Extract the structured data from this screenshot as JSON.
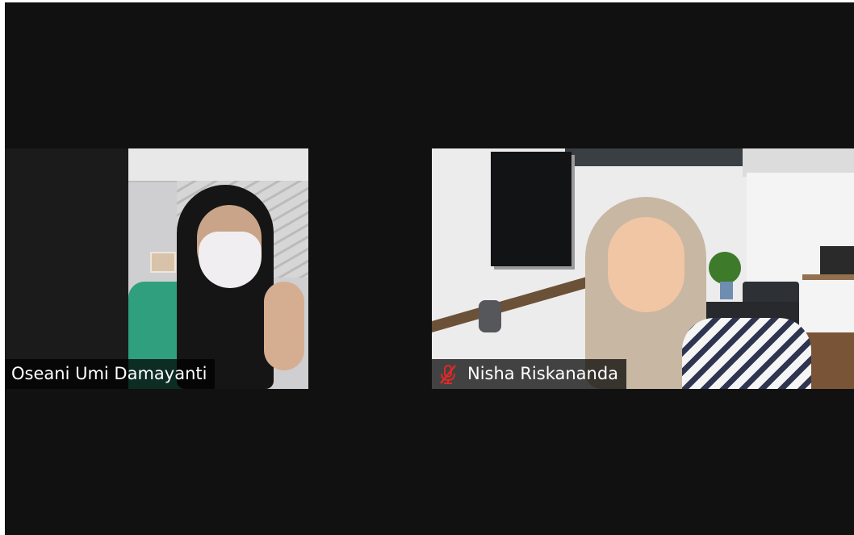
{
  "participants": [
    {
      "name": "Oseani Umi Damayanti",
      "muted": false
    },
    {
      "name": "Nisha Riskananda",
      "muted": true,
      "status_icon": "mic-muted-icon",
      "status_color": "#e02828"
    }
  ],
  "colors": {
    "background": "#111111",
    "label_background": "rgba(0,0,0,0.72)",
    "label_text": "#ffffff"
  }
}
